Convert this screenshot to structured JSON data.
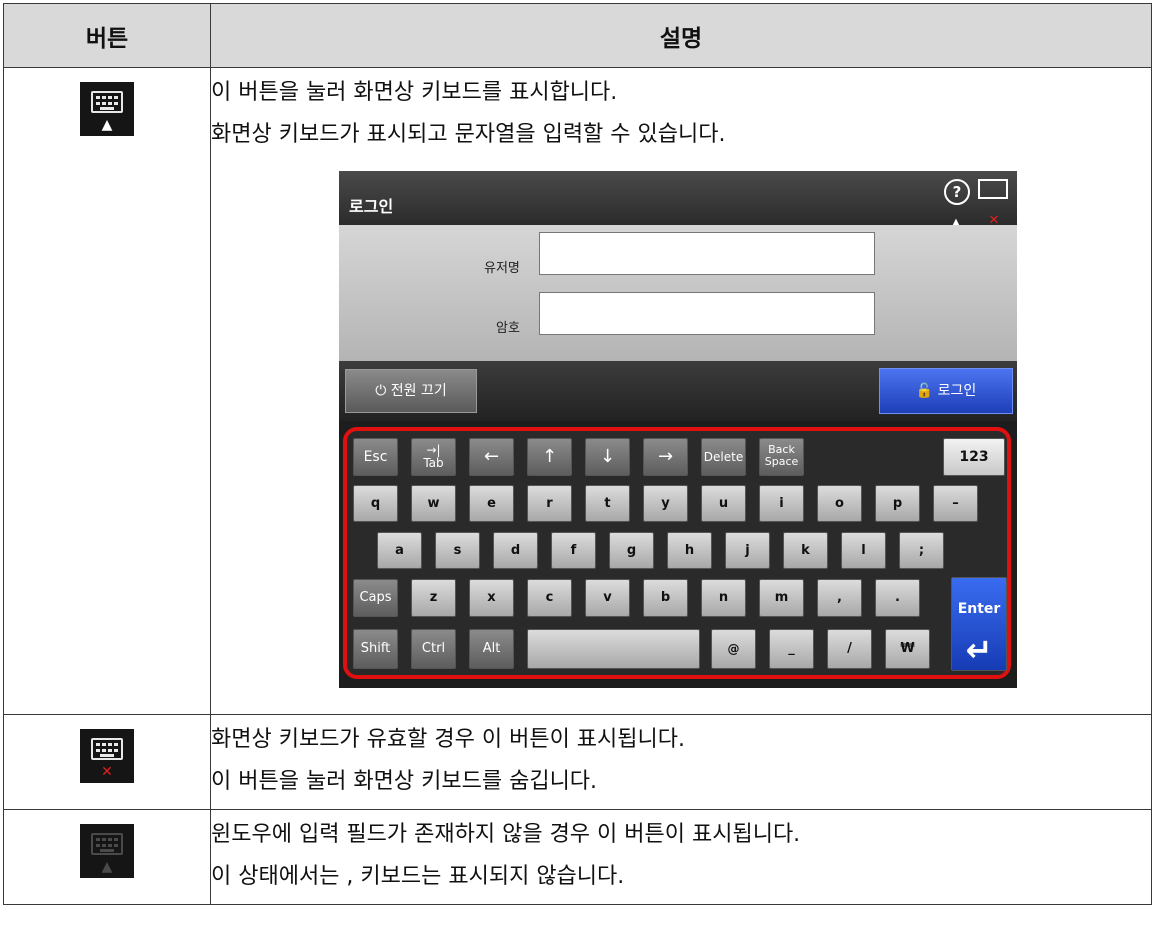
{
  "table": {
    "header_button": "버튼",
    "header_desc": "설명"
  },
  "rows": [
    {
      "icon": "keyboard-show-icon",
      "lines": [
        "이 버튼을 눌러 화면상 키보드를 표시합니다.",
        "화면상 키보드가 표시되고 문자열을 입력할 수 있습니다."
      ]
    },
    {
      "icon": "keyboard-hide-icon",
      "lines": [
        "화면상 키보드가 유효할 경우 이 버튼이 표시됩니다.",
        "이 버튼을 눌러 화면상 키보드를 숨깁니다."
      ]
    },
    {
      "icon": "keyboard-disabled-icon",
      "lines": [
        "윈도우에 입력 필드가 존재하지 않을 경우 이 버튼이 표시됩니다.",
        "이 상태에서는 , 키보드는 표시되지 않습니다."
      ]
    }
  ],
  "screenshot": {
    "title": "로그인",
    "help_glyph": "?",
    "username_label": "유저명",
    "password_label": "암호",
    "power_button": "⏻ 전원 끄기",
    "login_button": "🔓 로그인",
    "keyboard": {
      "row0": [
        "Esc",
        "→|\nTab",
        "←",
        "↑",
        "↓",
        "→",
        "Delete",
        "Back\nSpace",
        "123"
      ],
      "row1": [
        "q",
        "w",
        "e",
        "r",
        "t",
        "y",
        "u",
        "i",
        "o",
        "p",
        "–"
      ],
      "row2": [
        "a",
        "s",
        "d",
        "f",
        "g",
        "h",
        "j",
        "k",
        "l",
        ";"
      ],
      "row3": [
        "Caps",
        "z",
        "x",
        "c",
        "v",
        "b",
        "n",
        "m",
        ",",
        "."
      ],
      "row4": [
        "Shift",
        "Ctrl",
        "Alt",
        "",
        "@",
        "_",
        "/",
        "₩"
      ],
      "enter_label": "Enter",
      "enter_glyph": "↵"
    }
  }
}
